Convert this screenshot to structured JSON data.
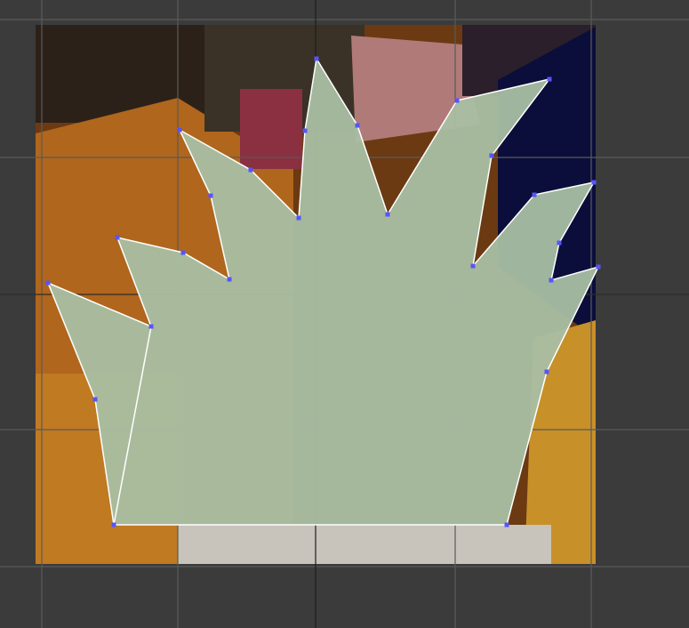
{
  "editor": {
    "tool": "polygon-annotation",
    "vertex_handle_icon": "square-handle-icon"
  },
  "colors": {
    "background": "#3b3b3b",
    "grid_line": "#5a5a5a",
    "polygon_fill": "#a9bfa3",
    "polygon_stroke": "#ffffff",
    "vertex_handle": "#5555ff"
  }
}
